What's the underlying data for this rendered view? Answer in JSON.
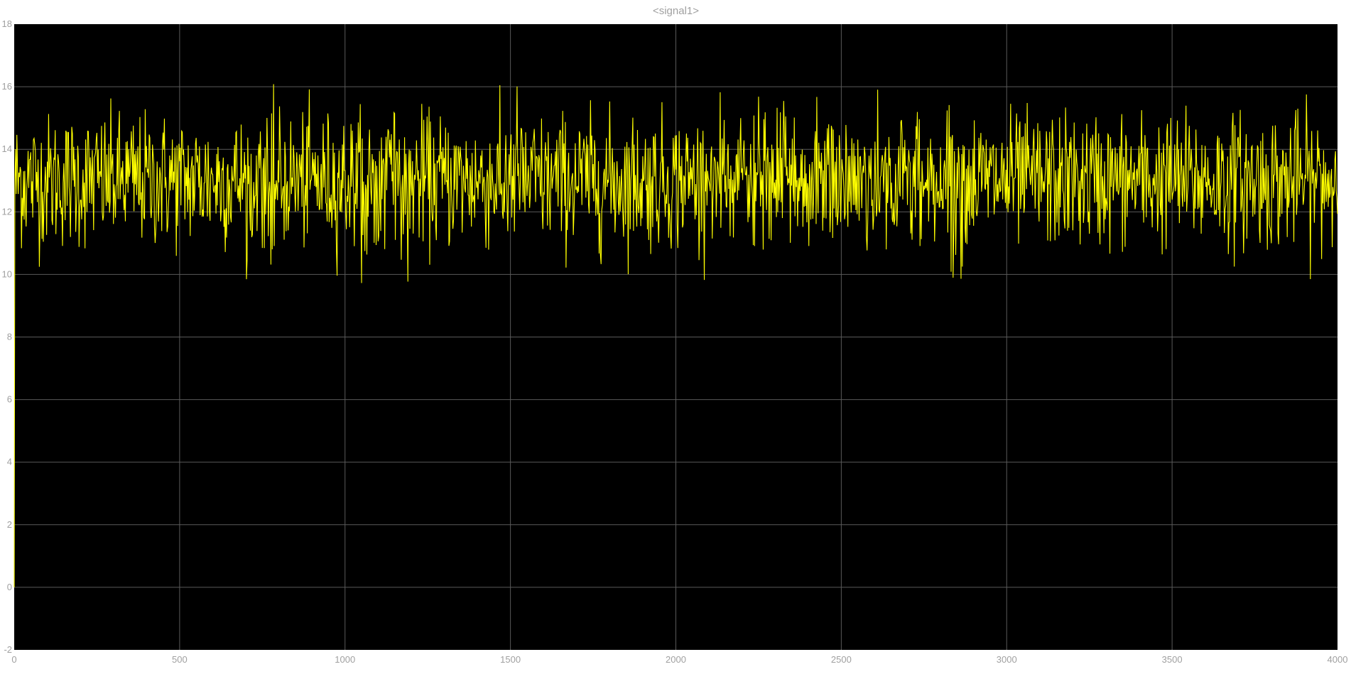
{
  "chart_data": {
    "type": "line",
    "title": "<signal1>",
    "xlabel": "",
    "ylabel": "",
    "xlim": [
      0,
      4000
    ],
    "ylim": [
      -2,
      18
    ],
    "x_ticks": [
      0,
      500,
      1000,
      1500,
      2000,
      2500,
      3000,
      3500,
      4000
    ],
    "y_ticks": [
      -2,
      0,
      2,
      4,
      6,
      8,
      10,
      12,
      14,
      16,
      18
    ],
    "grid": true,
    "legend": "none",
    "colors": {
      "background": "#000000",
      "grid": "#5a5a5a",
      "line": "#ffff00",
      "tick_text": "#a0a0a0"
    },
    "series": [
      {
        "color": "#ffff00",
        "sampling": {
          "x_start": 0,
          "x_end": 4000,
          "count": 2000
        },
        "initial": {
          "x": 0,
          "y": 0
        },
        "mean": 13.0,
        "std": 1.05,
        "min": 9.7,
        "max": 16.1
      }
    ]
  }
}
